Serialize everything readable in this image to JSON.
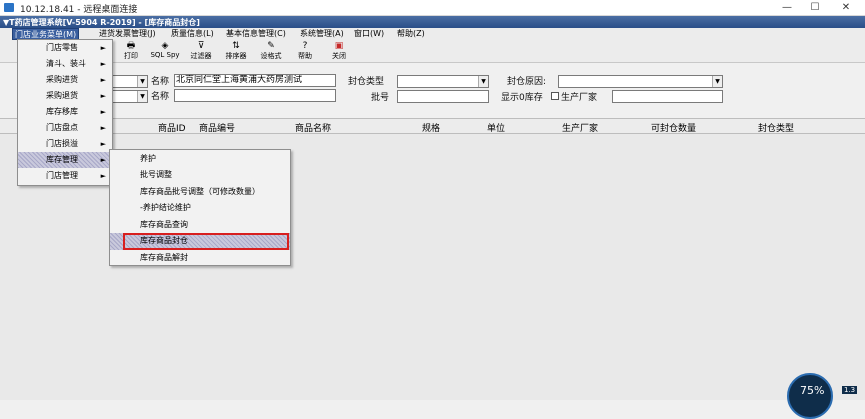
{
  "rdp": {
    "title": "10.12.18.41 - 远程桌面连接",
    "minimize": "—",
    "maximize": "☐",
    "close": "✕"
  },
  "app": {
    "title": "▼T药店管理系统[V-5904 R-2019] - [库存商品封仓]"
  },
  "menubar": [
    "门店业务菜单(M)",
    "进货发票管理(J)",
    "质量信息(L)",
    "基本信息管理(C)",
    "系统管理(A)",
    "窗口(W)",
    "帮助(Z)"
  ],
  "toolbar": [
    {
      "label": "打印",
      "icon": "printer-icon",
      "glyph": "🖶"
    },
    {
      "label": "SQL Spy",
      "icon": "sql-spy-icon",
      "glyph": "◈"
    },
    {
      "label": "过滤器",
      "icon": "filter-icon",
      "glyph": "⊽"
    },
    {
      "label": "排序器",
      "icon": "sort-icon",
      "glyph": "⇅"
    },
    {
      "label": "设格式",
      "icon": "format-icon",
      "glyph": "✎"
    },
    {
      "label": "帮助",
      "icon": "help-icon",
      "glyph": "?"
    },
    {
      "label": "关闭",
      "icon": "close-doc-icon",
      "glyph": "▣"
    }
  ],
  "form": {
    "name_label": "名称",
    "name_value": "北京同仁堂上海黄浦大药房测试",
    "name2_label": "名称",
    "seal_type_label": "封仓类型",
    "seal_reason_label": "封仓原因:",
    "batch_label": "批号",
    "show_zero_label": "显示0库存",
    "manufacturer_label": "生产厂家"
  },
  "grid_headers": [
    "商品ID",
    "商品编号",
    "商品名称",
    "规格",
    "单位",
    "生产厂家",
    "可封仓数量",
    "封仓类型"
  ],
  "menu1": [
    {
      "label": "门店零售",
      "arrow": "►"
    },
    {
      "label": "清斗、装斗",
      "arrow": "►"
    },
    {
      "label": "采购进货",
      "arrow": "►"
    },
    {
      "label": "采购退货",
      "arrow": "►"
    },
    {
      "label": "库存移库",
      "arrow": "►"
    },
    {
      "label": "门店盘点",
      "arrow": "►"
    },
    {
      "label": "门店损溢",
      "arrow": "►"
    },
    {
      "label": "库存管理",
      "arrow": "►"
    },
    {
      "label": "门店管理",
      "arrow": "►"
    }
  ],
  "menu2": [
    "养护",
    "批号调整",
    "库存商品批号调整（可修改数量）",
    "-养护结论维护",
    "库存商品查询",
    "库存商品封仓",
    "库存商品解封"
  ],
  "status": {
    "gauge": "75%",
    "side": "1.3"
  }
}
